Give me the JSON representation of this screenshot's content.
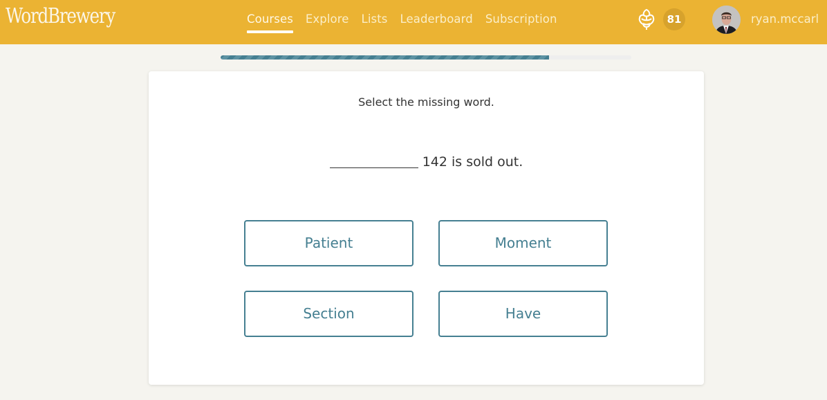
{
  "app": {
    "logo": "WordBrewery"
  },
  "nav": {
    "items": [
      {
        "label": "Courses",
        "active": true
      },
      {
        "label": "Explore",
        "active": false
      },
      {
        "label": "Lists",
        "active": false
      },
      {
        "label": "Leaderboard",
        "active": false
      },
      {
        "label": "Subscription",
        "active": false
      }
    ]
  },
  "user": {
    "points_icon": "hops-icon",
    "points": "81",
    "username": "ryan.mccarl",
    "avatar_icon": "avatar"
  },
  "quiz": {
    "progress_fraction": 0.8,
    "instruction": "Select the missing word.",
    "sentence_rest": "142 is sold out.",
    "choices": [
      "Patient",
      "Moment",
      "Section",
      "Have"
    ]
  },
  "colors": {
    "header": "#ebb333",
    "accent": "#457f91",
    "background": "#f5f4ef"
  }
}
